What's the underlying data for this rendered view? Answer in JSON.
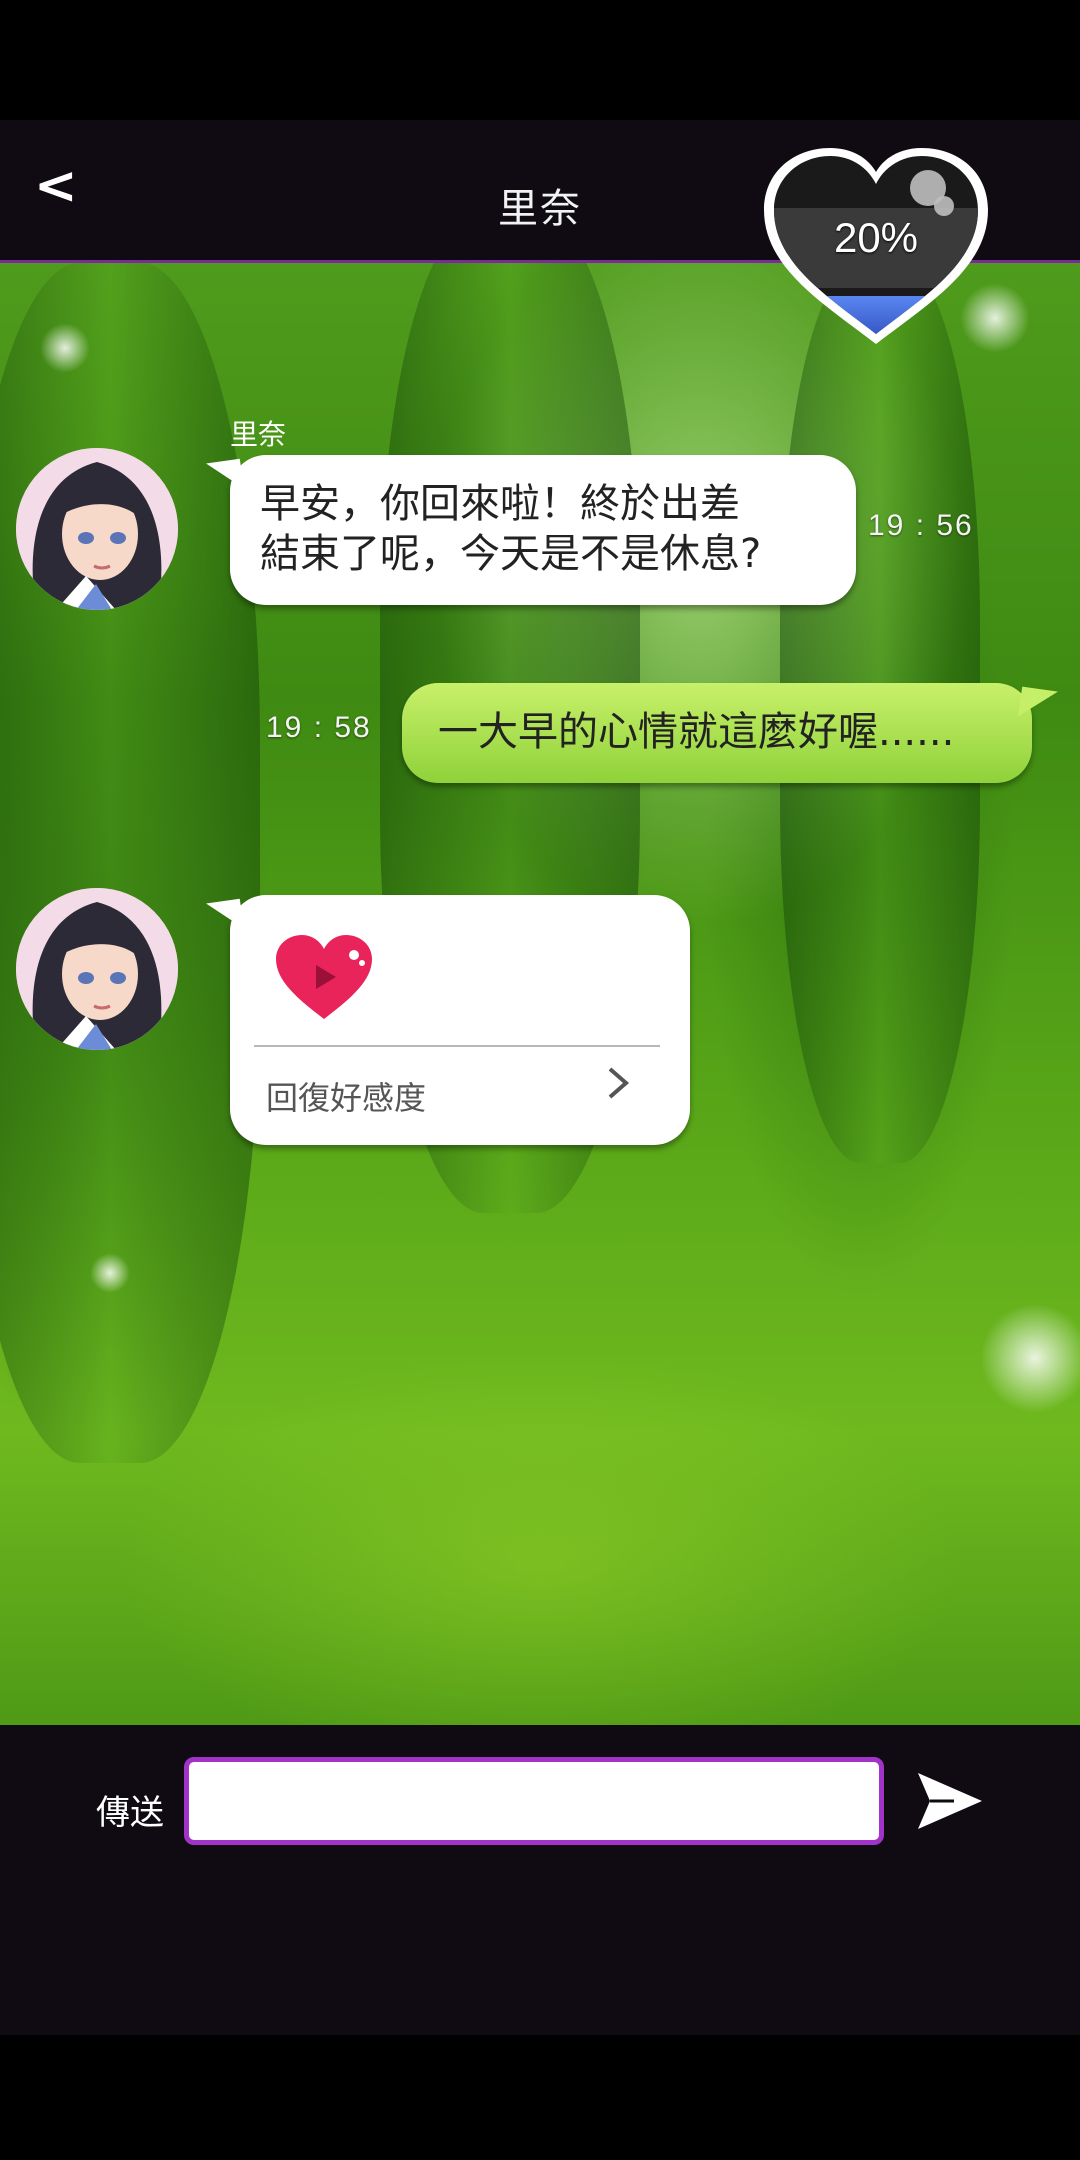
{
  "header": {
    "back_label": "<",
    "title": "里奈",
    "affection_percent_text": "20%",
    "affection_level": 0.2
  },
  "chat": {
    "sender_name": "里奈",
    "messages": [
      {
        "from": "里奈",
        "text": "早安，你回來啦！終於出差\n結束了呢，今天是不是休息?",
        "time": "19 : 56"
      },
      {
        "from": "me",
        "text": "一大早的心情就這麼好喔......",
        "time": "19 : 58"
      },
      {
        "from": "里奈",
        "card_label": "回復好感度",
        "card_icon": "heart-play-icon"
      }
    ]
  },
  "composer": {
    "send_label": "傳送",
    "input_value": "",
    "input_placeholder": ""
  },
  "colors": {
    "header_bg": "#100b12",
    "accent_purple": "#a233c8",
    "my_bubble": "#b5e85a",
    "heart_red": "#e8245a",
    "meter_blue": "#3a62d8"
  }
}
